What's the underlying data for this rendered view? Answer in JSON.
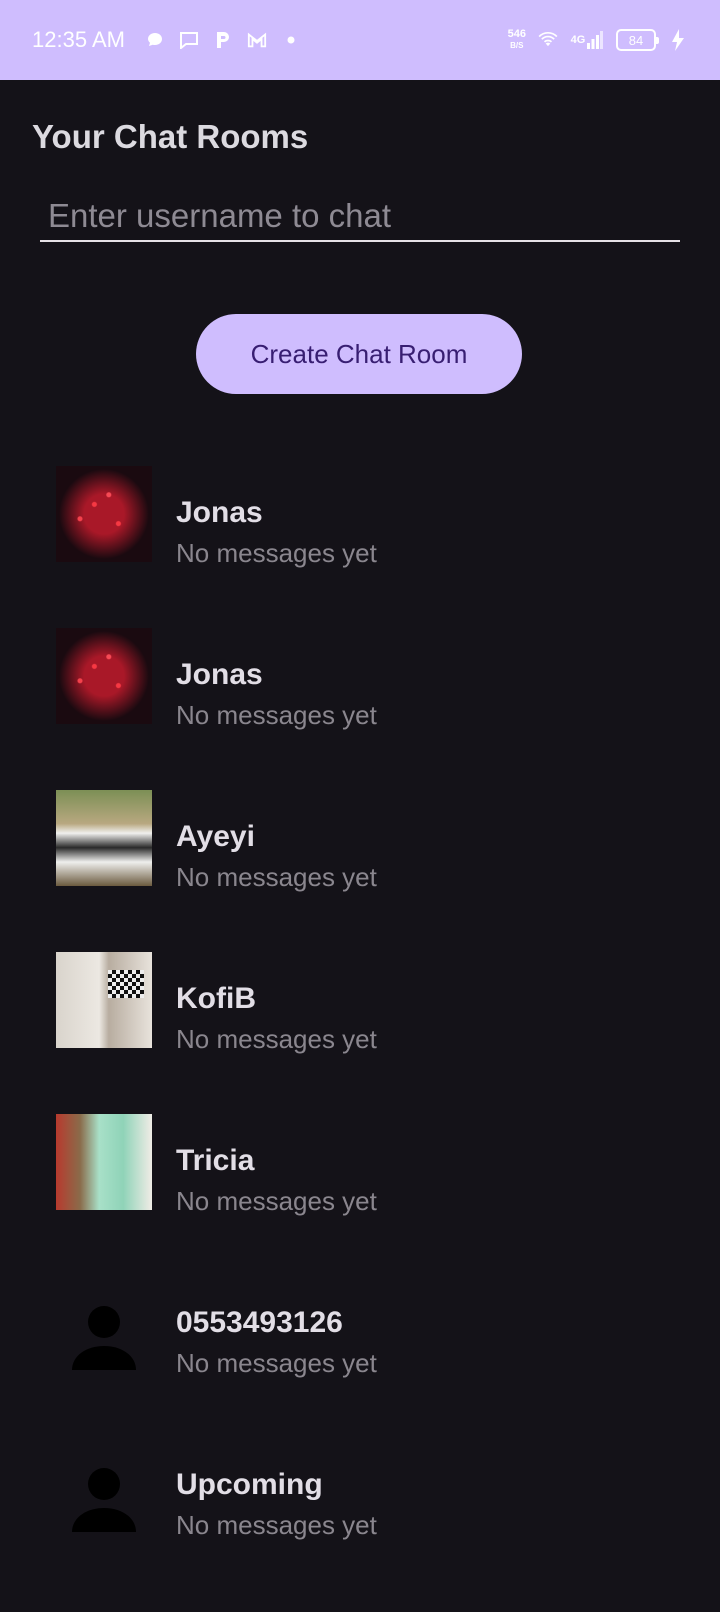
{
  "status_bar": {
    "time": "12:35 AM",
    "net_speed_value": "546",
    "net_speed_unit": "B/S",
    "network": "4G",
    "battery": "84",
    "icons": [
      "chat-bubble-icon",
      "message-icon",
      "p-app-icon",
      "gmail-icon",
      "dot-icon",
      "wifi-icon",
      "signal-icon",
      "charging-icon"
    ]
  },
  "header": {
    "title": "Your Chat Rooms"
  },
  "search": {
    "placeholder": "Enter username to chat",
    "value": ""
  },
  "create_button": {
    "label": "Create Chat Room"
  },
  "rooms": [
    {
      "name": "Jonas",
      "preview": "No messages yet",
      "avatar": "fireworks-photo"
    },
    {
      "name": "Jonas",
      "preview": "No messages yet",
      "avatar": "fireworks-photo"
    },
    {
      "name": "Ayeyi",
      "preview": "No messages yet",
      "avatar": "group-photo"
    },
    {
      "name": "KofiB",
      "preview": "No messages yet",
      "avatar": "room-photo"
    },
    {
      "name": "Tricia",
      "preview": "No messages yet",
      "avatar": "person-photo"
    },
    {
      "name": "0553493126",
      "preview": "No messages yet",
      "avatar": "default-person-icon"
    },
    {
      "name": "Upcoming",
      "preview": "No messages yet",
      "avatar": "default-person-icon"
    }
  ],
  "colors": {
    "accent": "#cfbdfe",
    "background": "#141218",
    "button_text": "#381e72"
  }
}
